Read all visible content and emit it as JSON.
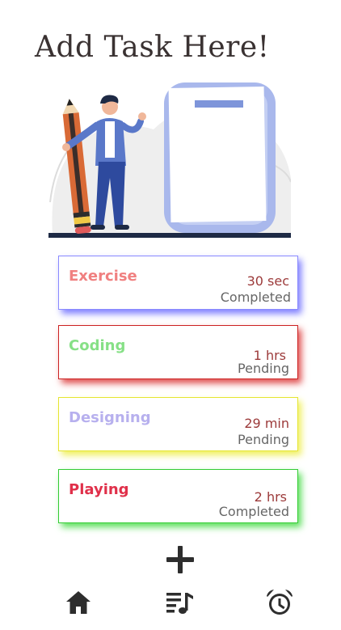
{
  "header": {
    "title": "Add Task Here!"
  },
  "tasks": [
    {
      "name": "Exercise",
      "duration": "30 sec",
      "status": "Completed",
      "name_color": "#f08080",
      "border_color": "#8a8aff",
      "shadow_color": "#8080ff"
    },
    {
      "name": "Coding",
      "duration": "1 hrs",
      "status": "Pending",
      "name_color": "#86e086",
      "border_color": "#cc2222",
      "shadow_color": "#e05050"
    },
    {
      "name": "Designing",
      "duration": "29 min",
      "status": "Pending",
      "name_color": "#b7b0ee",
      "border_color": "#e5e530",
      "shadow_color": "#f0f060"
    },
    {
      "name": "Playing",
      "duration": "2 hrs",
      "status": "Completed",
      "name_color": "#e0304a",
      "border_color": "#33cc33",
      "shadow_color": "#60e060"
    }
  ],
  "actions": {
    "add_icon": "plus-icon"
  },
  "bottom_nav": [
    {
      "icon": "home-icon"
    },
    {
      "icon": "playlist-icon"
    },
    {
      "icon": "alarm-clock-icon"
    }
  ]
}
